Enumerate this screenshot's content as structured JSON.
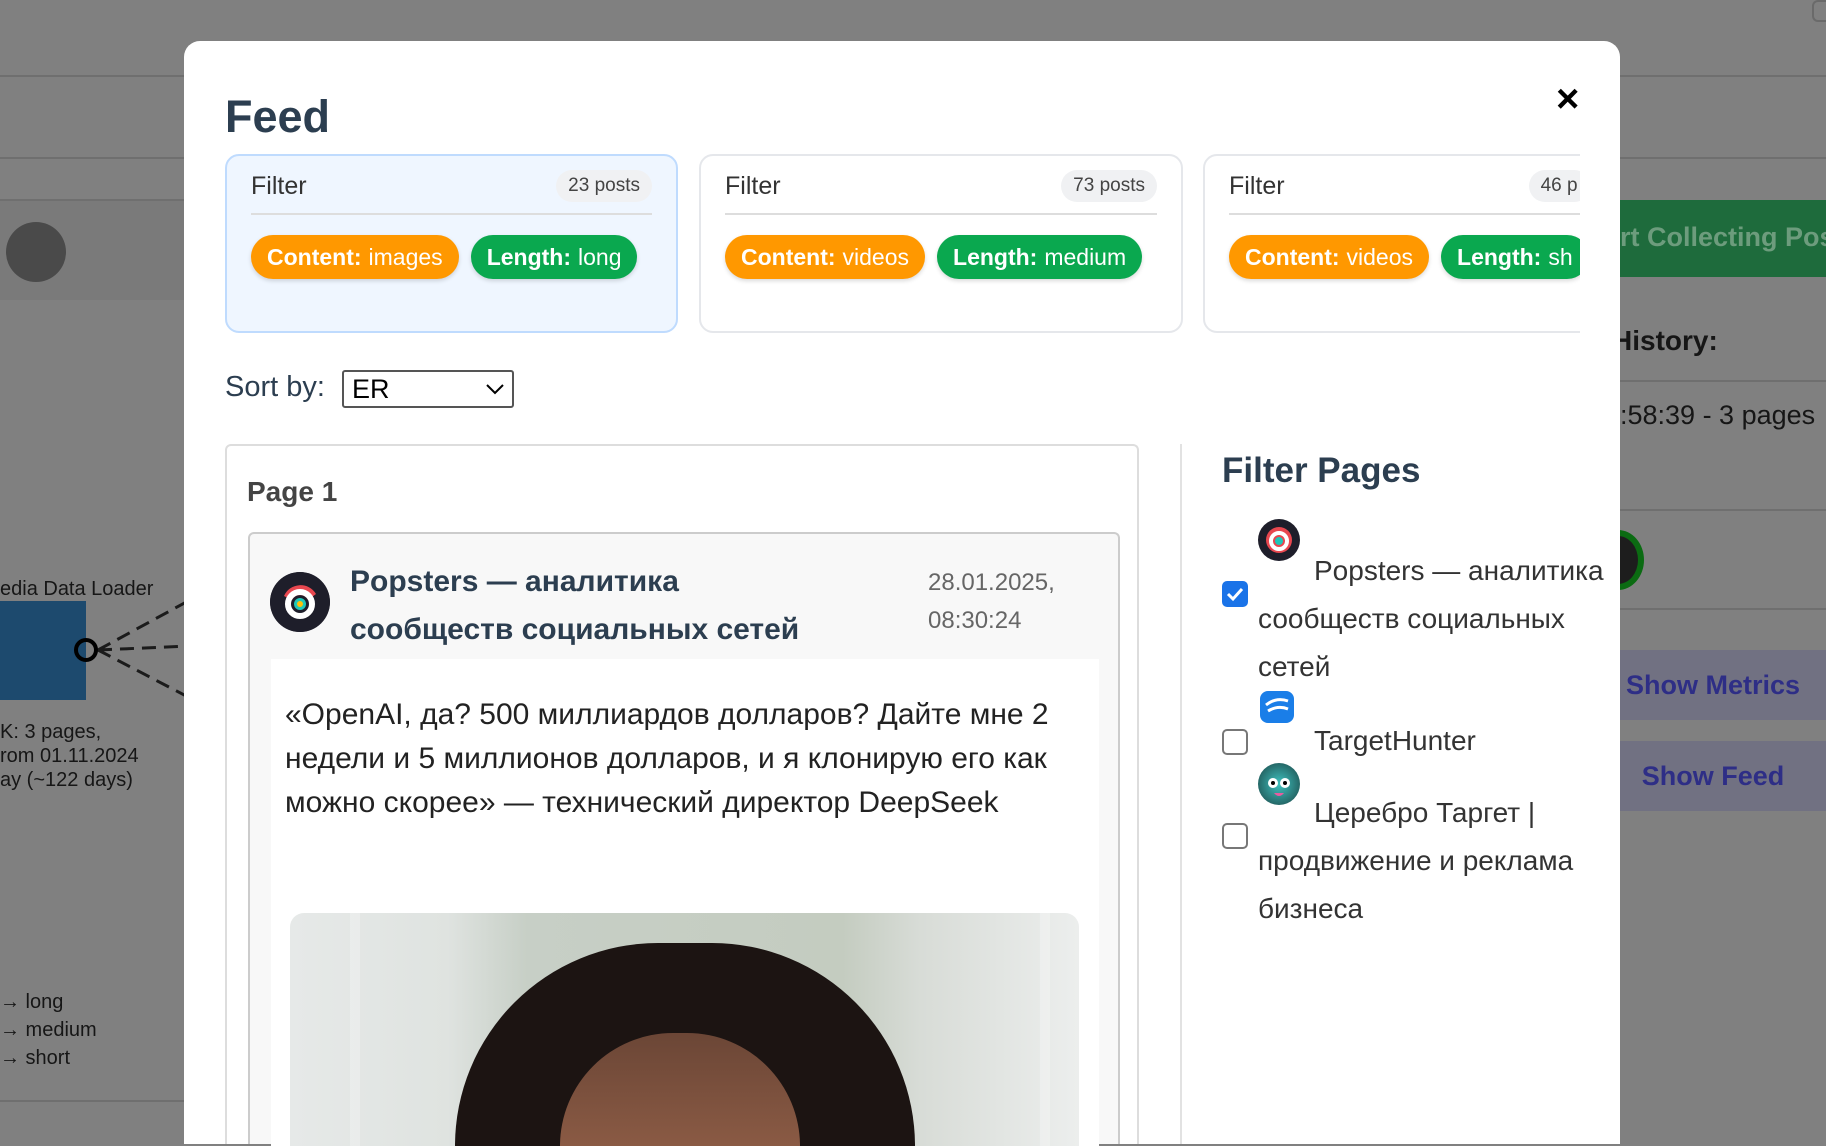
{
  "background": {
    "collect_button": "rt Collecting Pos",
    "history_label": "History:",
    "history_entry": ":58:39 - 3 pages",
    "show_metrics": "Show Metrics",
    "show_feed": "Show Feed",
    "diagram_node_label": "edia Data Loader",
    "diagram_caption": [
      "K: 3 pages,",
      "rom 01.11.2024",
      "ay (~122 days)"
    ],
    "legend": [
      "→ long",
      "→ medium",
      "→ short"
    ]
  },
  "modal": {
    "title": "Feed",
    "close_icon": "×",
    "filters": [
      {
        "label": "Filter",
        "count": "23 posts",
        "active": true,
        "tags": [
          {
            "key": "Content:",
            "value": "images",
            "color": "#ff9800"
          },
          {
            "key": "Length:",
            "value": "long",
            "color": "#0aa84f"
          }
        ]
      },
      {
        "label": "Filter",
        "count": "73 posts",
        "active": false,
        "tags": [
          {
            "key": "Content:",
            "value": "videos",
            "color": "#ff9800"
          },
          {
            "key": "Length:",
            "value": "medium",
            "color": "#0aa84f"
          }
        ]
      },
      {
        "label": "Filter",
        "count": "46 p",
        "active": false,
        "tags": [
          {
            "key": "Content:",
            "value": "videos",
            "color": "#ff9800"
          },
          {
            "key": "Length:",
            "value": "sh",
            "color": "#0aa84f"
          }
        ]
      }
    ],
    "sort": {
      "label": "Sort by:",
      "value": "ER"
    },
    "page": {
      "title": "Page 1",
      "post": {
        "author": "Popsters — аналитика сообществ социальных сетей",
        "date": "28.01.2025,",
        "time": "08:30:24",
        "text": "«OpenAI, да? 500 миллиардов долларов? Дайте мне 2 недели и 5 миллионов долларов, и я клонирую его как можно скорее» — технический директор DeepSeek"
      }
    },
    "filter_pages": {
      "title": "Filter Pages",
      "items": [
        {
          "name": "Popsters — аналитика сообществ социальных сетей",
          "checked": true
        },
        {
          "name": "TargetHunter",
          "checked": false
        },
        {
          "name": "Церебро Таргет | продвижение и реклама бизнеса",
          "checked": false
        }
      ]
    }
  }
}
